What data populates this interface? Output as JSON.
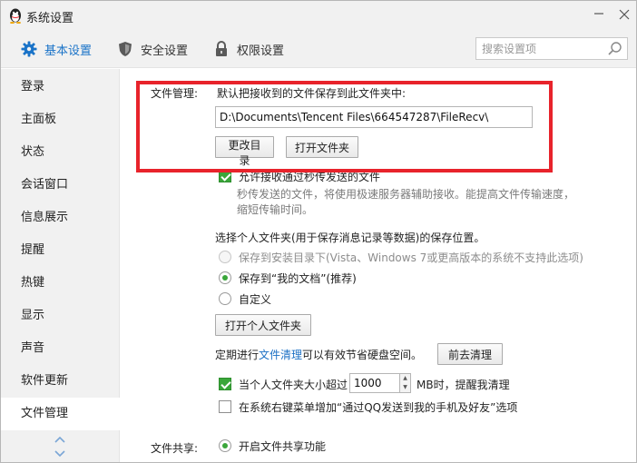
{
  "window": {
    "title": "系统设置"
  },
  "nav": {
    "tabs": [
      {
        "label": "基本设置",
        "icon": "gear-icon",
        "active": true
      },
      {
        "label": "安全设置",
        "icon": "shield-icon"
      },
      {
        "label": "权限设置",
        "icon": "lock-icon"
      }
    ],
    "search_placeholder": "搜索设置项"
  },
  "sidebar": {
    "items": [
      "登录",
      "主面板",
      "状态",
      "会话窗口",
      "信息展示",
      "提醒",
      "热键",
      "显示",
      "声音",
      "软件更新",
      "文件管理"
    ],
    "active": "文件管理"
  },
  "file_management": {
    "section_label": "文件管理:",
    "save_desc": "默认把接收到的文件保存到此文件夹中:",
    "save_path": "D:\\Documents\\Tencent Files\\664547287\\FileRecv\\",
    "change_dir_label": "更改目录",
    "open_folder_label": "打开文件夹",
    "allow_fast_label": "允许接收通过秒传发送的文件",
    "allow_fast_checked": true,
    "fast_desc": "秒传发送的文件，将使用极速服务器辅助接收。能提高文件传输速度，缩短传输时间。",
    "personal_folder_desc": "选择个人文件夹(用于保存消息记录等数据)的保存位置。",
    "radio_install": "保存到安装目录下(Vista、Windows 7或更高版本的系统不支持此选项)",
    "radio_mydocs": "保存到“我的文档”(推荐)",
    "radio_custom": "自定义",
    "selected_radio": "mydocs",
    "open_personal_label": "打开个人文件夹",
    "cleanup_prefix": "定期进行",
    "cleanup_link": "文件清理",
    "cleanup_suffix": "可以有效节省硬盘空间。",
    "cleanup_button_label": "前去清理",
    "size_prefix": "当个人文件夹大小超过",
    "size_value": "1000",
    "size_suffix": "MB时，提醒我清理",
    "size_checked": true,
    "context_menu_label": "在系统右键菜单增加“通过QQ发送到我的手机及好友”选项",
    "context_menu_checked": false
  },
  "file_sharing": {
    "section_label": "文件共享:",
    "enable_label": "开启文件共享功能",
    "enable_checked": true
  },
  "colors": {
    "accent": "#1a73c8",
    "highlight": "#e8232b",
    "check": "#3aa63a"
  }
}
